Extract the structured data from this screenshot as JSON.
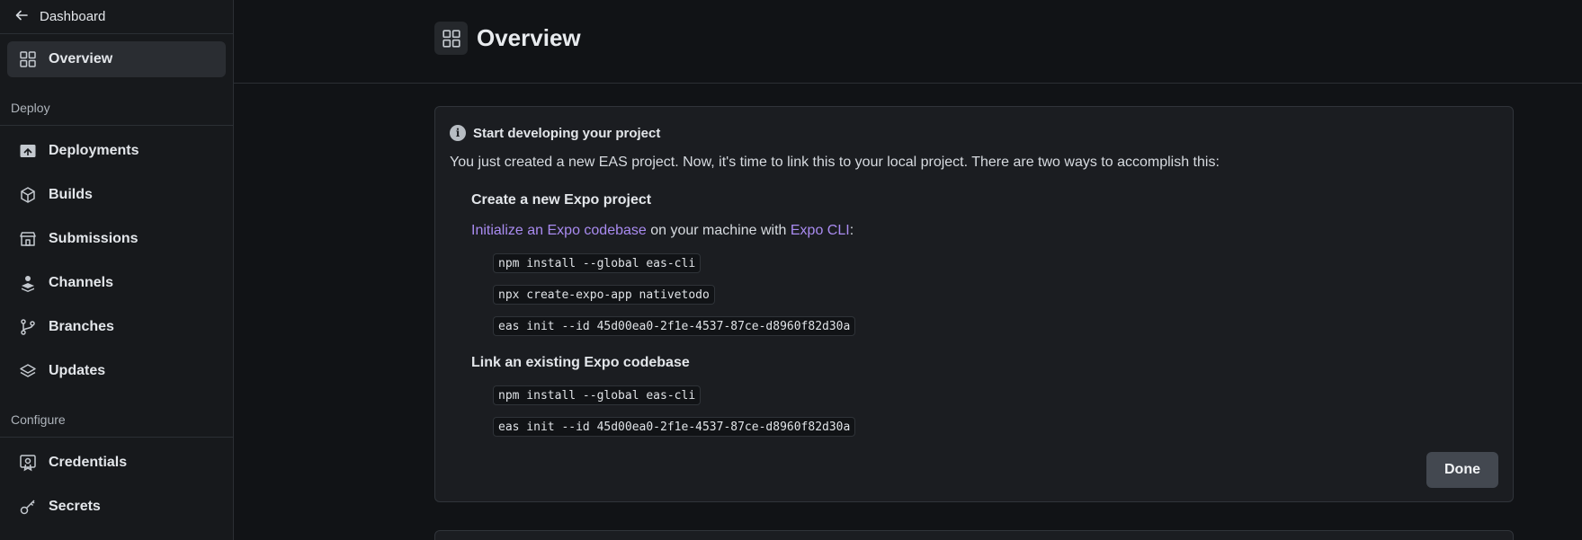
{
  "sidebar": {
    "back_label": "Dashboard",
    "overview_label": "Overview",
    "sections": {
      "deploy": "Deploy",
      "configure": "Configure"
    },
    "items": [
      {
        "label": "Deployments",
        "icon": "deployments-icon"
      },
      {
        "label": "Builds",
        "icon": "cube-icon"
      },
      {
        "label": "Submissions",
        "icon": "store-icon"
      },
      {
        "label": "Channels",
        "icon": "channels-icon"
      },
      {
        "label": "Branches",
        "icon": "branch-icon"
      },
      {
        "label": "Updates",
        "icon": "layers-icon"
      },
      {
        "label": "Credentials",
        "icon": "credentials-icon"
      },
      {
        "label": "Secrets",
        "icon": "key-icon"
      }
    ]
  },
  "header": {
    "title": "Overview"
  },
  "card": {
    "title": "Start developing your project",
    "intro": "You just created a new EAS project. Now, it's time to link this to your local project. There are two ways to accomplish this:",
    "new_project": {
      "heading": "Create a new Expo project",
      "link1": "Initialize an Expo codebase",
      "middle": " on your machine with ",
      "link2": "Expo CLI",
      "suffix": ":",
      "commands": [
        "npm install --global eas-cli",
        "npx create-expo-app nativetodo",
        "eas init --id 45d00ea0-2f1e-4537-87ce-d8960f82d30a"
      ]
    },
    "existing": {
      "heading": "Link an existing Expo codebase",
      "commands": [
        "npm install --global eas-cli",
        "eas init --id 45d00ea0-2f1e-4537-87ce-d8960f82d30a"
      ]
    },
    "done_label": "Done"
  },
  "colors": {
    "background": "#111316",
    "sidebar": "#17191c",
    "link": "#a98bf0",
    "button": "#434850"
  }
}
